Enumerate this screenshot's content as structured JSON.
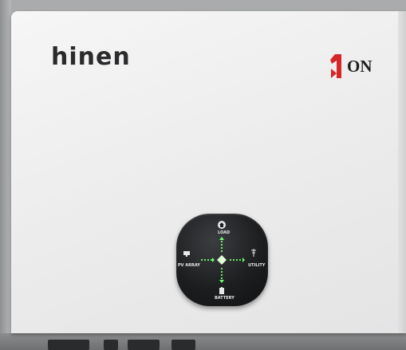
{
  "brand": {
    "left_logo": "hinen",
    "right_logo_text": "ON",
    "right_logo_mark": "1"
  },
  "control_panel": {
    "load_label": "LOAD",
    "pv_label": "PV ARRAY",
    "utility_label": "UTILITY",
    "battery_label": "BATTERY",
    "icons": [
      "home-icon",
      "solar-panel-icon",
      "utility-tower-icon",
      "battery-icon"
    ],
    "flow_color": "#6cff6c",
    "pad_color": "#1d1e20"
  },
  "colors": {
    "panel": "#ededed",
    "accent_red": "#d7262a"
  }
}
